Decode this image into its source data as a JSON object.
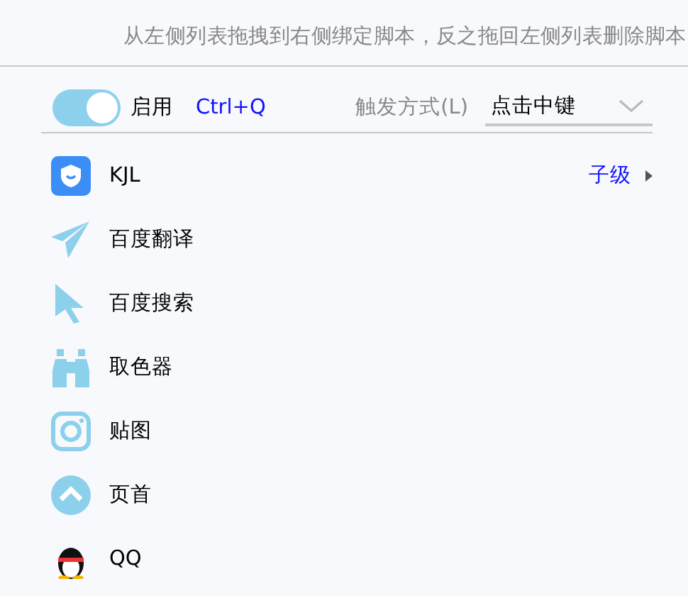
{
  "hint": "从左侧列表拖拽到右侧绑定脚本，反之拖回左侧列表删除脚本",
  "toolbar": {
    "toggle": {
      "label": "启用",
      "on": true
    },
    "hotkey": "Ctrl+Q",
    "trigger_label": "触发方式(L)",
    "trigger": {
      "value": "点击中键"
    }
  },
  "items": [
    {
      "label": "KJL",
      "submenu_label": "子级"
    },
    {
      "label": "百度翻译"
    },
    {
      "label": "百度搜索"
    },
    {
      "label": "取色器"
    },
    {
      "label": "贴图"
    },
    {
      "label": "页首"
    },
    {
      "label": "QQ"
    }
  ]
}
